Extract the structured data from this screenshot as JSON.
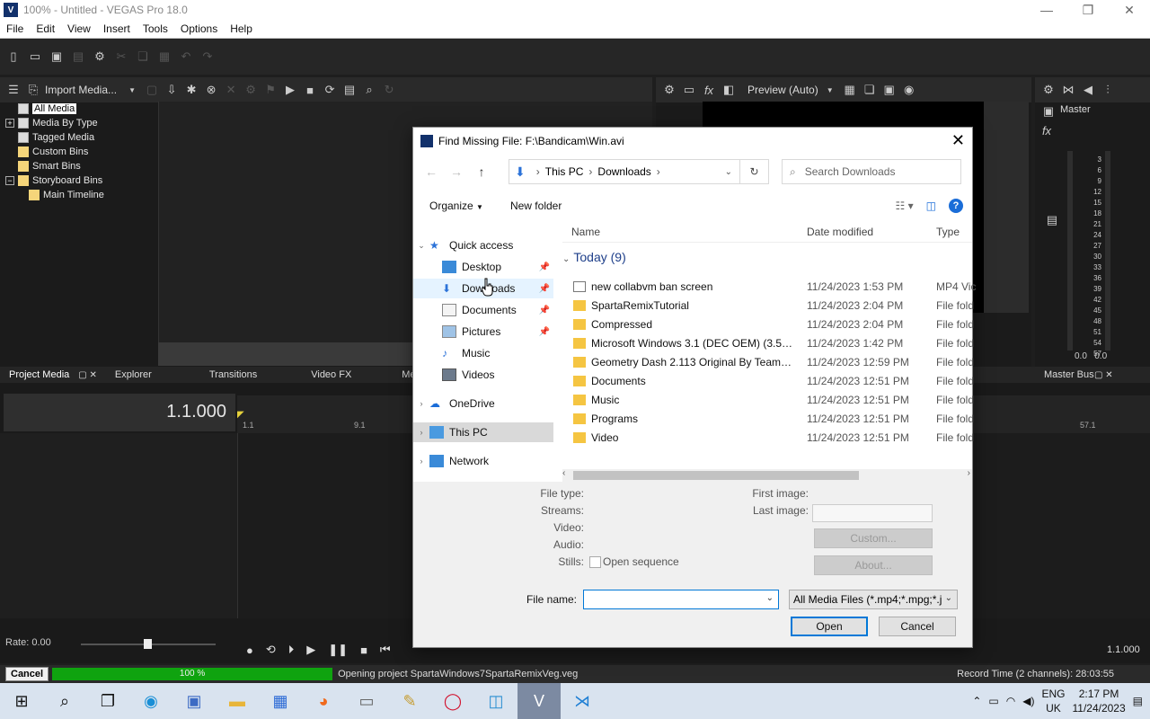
{
  "window": {
    "title": "100% - Untitled - VEGAS Pro 18.0",
    "app_icon_letter": "V",
    "minimize": "—",
    "restore": "❐",
    "close": "✕"
  },
  "menu": [
    "File",
    "Edit",
    "View",
    "Insert",
    "Tools",
    "Options",
    "Help"
  ],
  "media_panel": {
    "import_label": "Import Media...",
    "tree": [
      {
        "label": "All Media",
        "selected": true
      },
      {
        "label": "Media By Type"
      },
      {
        "label": "Tagged Media"
      },
      {
        "label": "Custom Bins"
      },
      {
        "label": "Smart Bins"
      },
      {
        "label": "Storyboard Bins"
      },
      {
        "label": "Main Timeline"
      }
    ]
  },
  "preview_panel": {
    "preview_label": "Preview (Auto)"
  },
  "master": {
    "label": "Master",
    "scale": [
      "3",
      "6",
      "9",
      "12",
      "15",
      "18",
      "21",
      "24",
      "27",
      "30",
      "33",
      "36",
      "39",
      "42",
      "45",
      "48",
      "51",
      "54",
      "57"
    ],
    "left_value": "0.0",
    "right_value": "0.0"
  },
  "tabs": [
    "Project Media",
    "Explorer",
    "Transitions",
    "Video FX",
    "Media G",
    "Master Bus"
  ],
  "timeline": {
    "timecode": "1.1.000",
    "ruler_marks": [
      "1.1",
      "9.1",
      "57.1"
    ],
    "rate": "Rate: 0.00",
    "end_timecode": "1.1.000"
  },
  "status": {
    "cancel": "Cancel",
    "progress_pct": 100,
    "progress_label": "100 %",
    "message": "Opening project SpartaWindows7SpartaRemixVeg.veg",
    "record_time": "Record Time (2 channels): 28:03:55"
  },
  "taskbar": {
    "lang_top": "ENG",
    "lang_bottom": "UK",
    "time": "2:17 PM",
    "date": "11/24/2023"
  },
  "dialog": {
    "title": "Find Missing File: F:\\Bandicam\\Win.avi",
    "address": [
      "This PC",
      "Downloads"
    ],
    "search_placeholder": "Search Downloads",
    "organize": "Organize",
    "new_folder": "New folder",
    "nav": [
      {
        "label": "Quick access",
        "type": "star"
      },
      {
        "label": "Desktop",
        "type": "desktop",
        "pinned": true
      },
      {
        "label": "Downloads",
        "type": "download",
        "pinned": true,
        "hover": true
      },
      {
        "label": "Documents",
        "type": "docs",
        "pinned": true
      },
      {
        "label": "Pictures",
        "type": "pictures",
        "pinned": true
      },
      {
        "label": "Music",
        "type": "music"
      },
      {
        "label": "Videos",
        "type": "videos"
      },
      {
        "label": "OneDrive",
        "type": "cloud"
      },
      {
        "label": "This PC",
        "type": "pc",
        "selected": true
      },
      {
        "label": "Network",
        "type": "network"
      }
    ],
    "columns": {
      "name": "Name",
      "date": "Date modified",
      "type": "Type"
    },
    "group": "Today (9)",
    "files": [
      {
        "name": "new collabvm ban screen",
        "date": "11/24/2023 1:53 PM",
        "type": "MP4 Vic",
        "kind": "video"
      },
      {
        "name": "SpartaRemixTutorial",
        "date": "11/24/2023 2:04 PM",
        "type": "File fold",
        "kind": "folder"
      },
      {
        "name": "Compressed",
        "date": "11/24/2023 2:04 PM",
        "type": "File fold",
        "kind": "folder"
      },
      {
        "name": "Microsoft Windows 3.1 (DEC OEM) (3.5-1...",
        "date": "11/24/2023 1:42 PM",
        "type": "File fold",
        "kind": "folder"
      },
      {
        "name": "Geometry Dash 2.113 Original By TeamHax",
        "date": "11/24/2023 12:59 PM",
        "type": "File fold",
        "kind": "folder"
      },
      {
        "name": "Documents",
        "date": "11/24/2023 12:51 PM",
        "type": "File fold",
        "kind": "folder"
      },
      {
        "name": "Music",
        "date": "11/24/2023 12:51 PM",
        "type": "File fold",
        "kind": "folder"
      },
      {
        "name": "Programs",
        "date": "11/24/2023 12:51 PM",
        "type": "File fold",
        "kind": "folder"
      },
      {
        "name": "Video",
        "date": "11/24/2023 12:51 PM",
        "type": "File fold",
        "kind": "folder"
      }
    ],
    "info": {
      "file_type": "File type:",
      "streams": "Streams:",
      "video": "Video:",
      "audio": "Audio:",
      "stills": "Stills:",
      "open_sequence": "Open sequence",
      "first_image": "First image:",
      "last_image": "Last image:",
      "custom": "Custom...",
      "about": "About..."
    },
    "file_name_label": "File name:",
    "file_name_value": "",
    "file_type_filter": "All Media Files (*.mp4;*.mpg;*.j",
    "open": "Open",
    "cancel": "Cancel"
  }
}
